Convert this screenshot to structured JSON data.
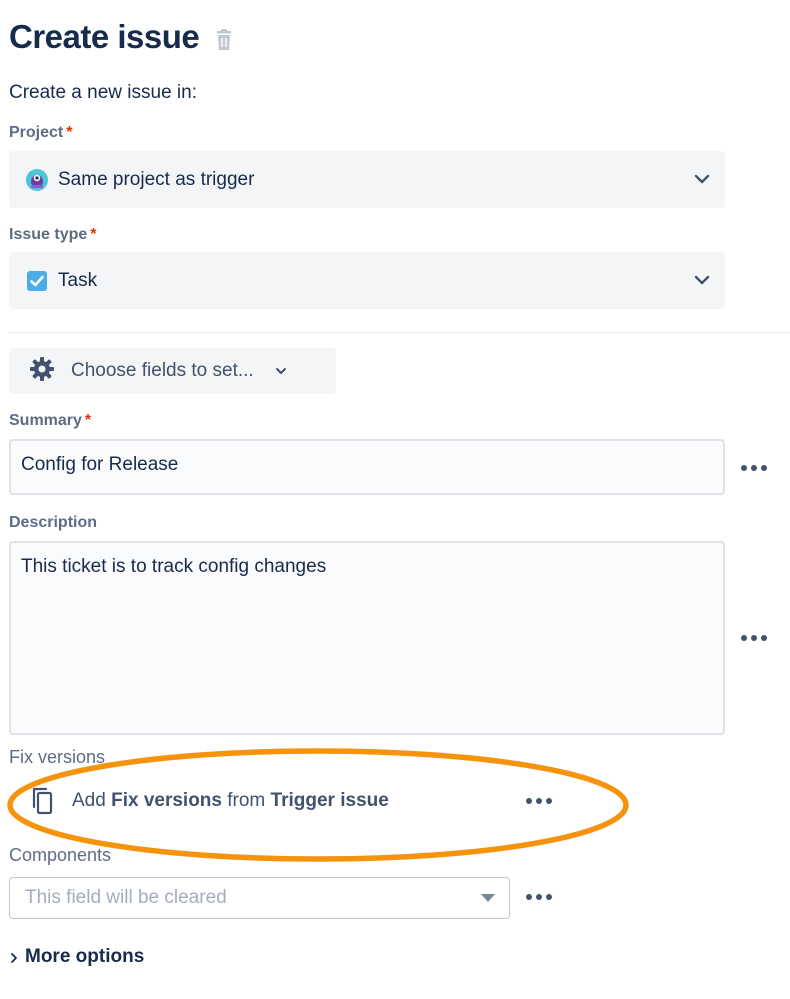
{
  "header": {
    "title": "Create issue",
    "delete_icon": "trash-icon"
  },
  "intro": "Create a new issue in:",
  "project": {
    "label": "Project",
    "required_mark": "*",
    "value": "Same project as trigger",
    "icon": "project-avatar-icon"
  },
  "issue_type": {
    "label": "Issue type",
    "required_mark": "*",
    "value": "Task",
    "icon": "task-checkbox-icon"
  },
  "choose_fields": {
    "label": "Choose fields to set...",
    "icon": "gear-icon"
  },
  "summary": {
    "label": "Summary",
    "required_mark": "*",
    "value": "Config for Release"
  },
  "description": {
    "label": "Description",
    "value": "This ticket is to track config changes"
  },
  "fix_versions": {
    "label": "Fix versions",
    "text_pre": "Add ",
    "text_field": "Fix versions",
    "text_mid": " from ",
    "text_source": "Trigger issue",
    "icon": "copy-icon"
  },
  "components": {
    "label": "Components",
    "placeholder": "This field will be cleared"
  },
  "more_options": {
    "label": "More options"
  },
  "colors": {
    "primary_text": "#172b4d",
    "label_text": "#5e6c84",
    "required": "#de350b",
    "field_bg": "#f4f5f7",
    "highlight": "#f5930c"
  }
}
